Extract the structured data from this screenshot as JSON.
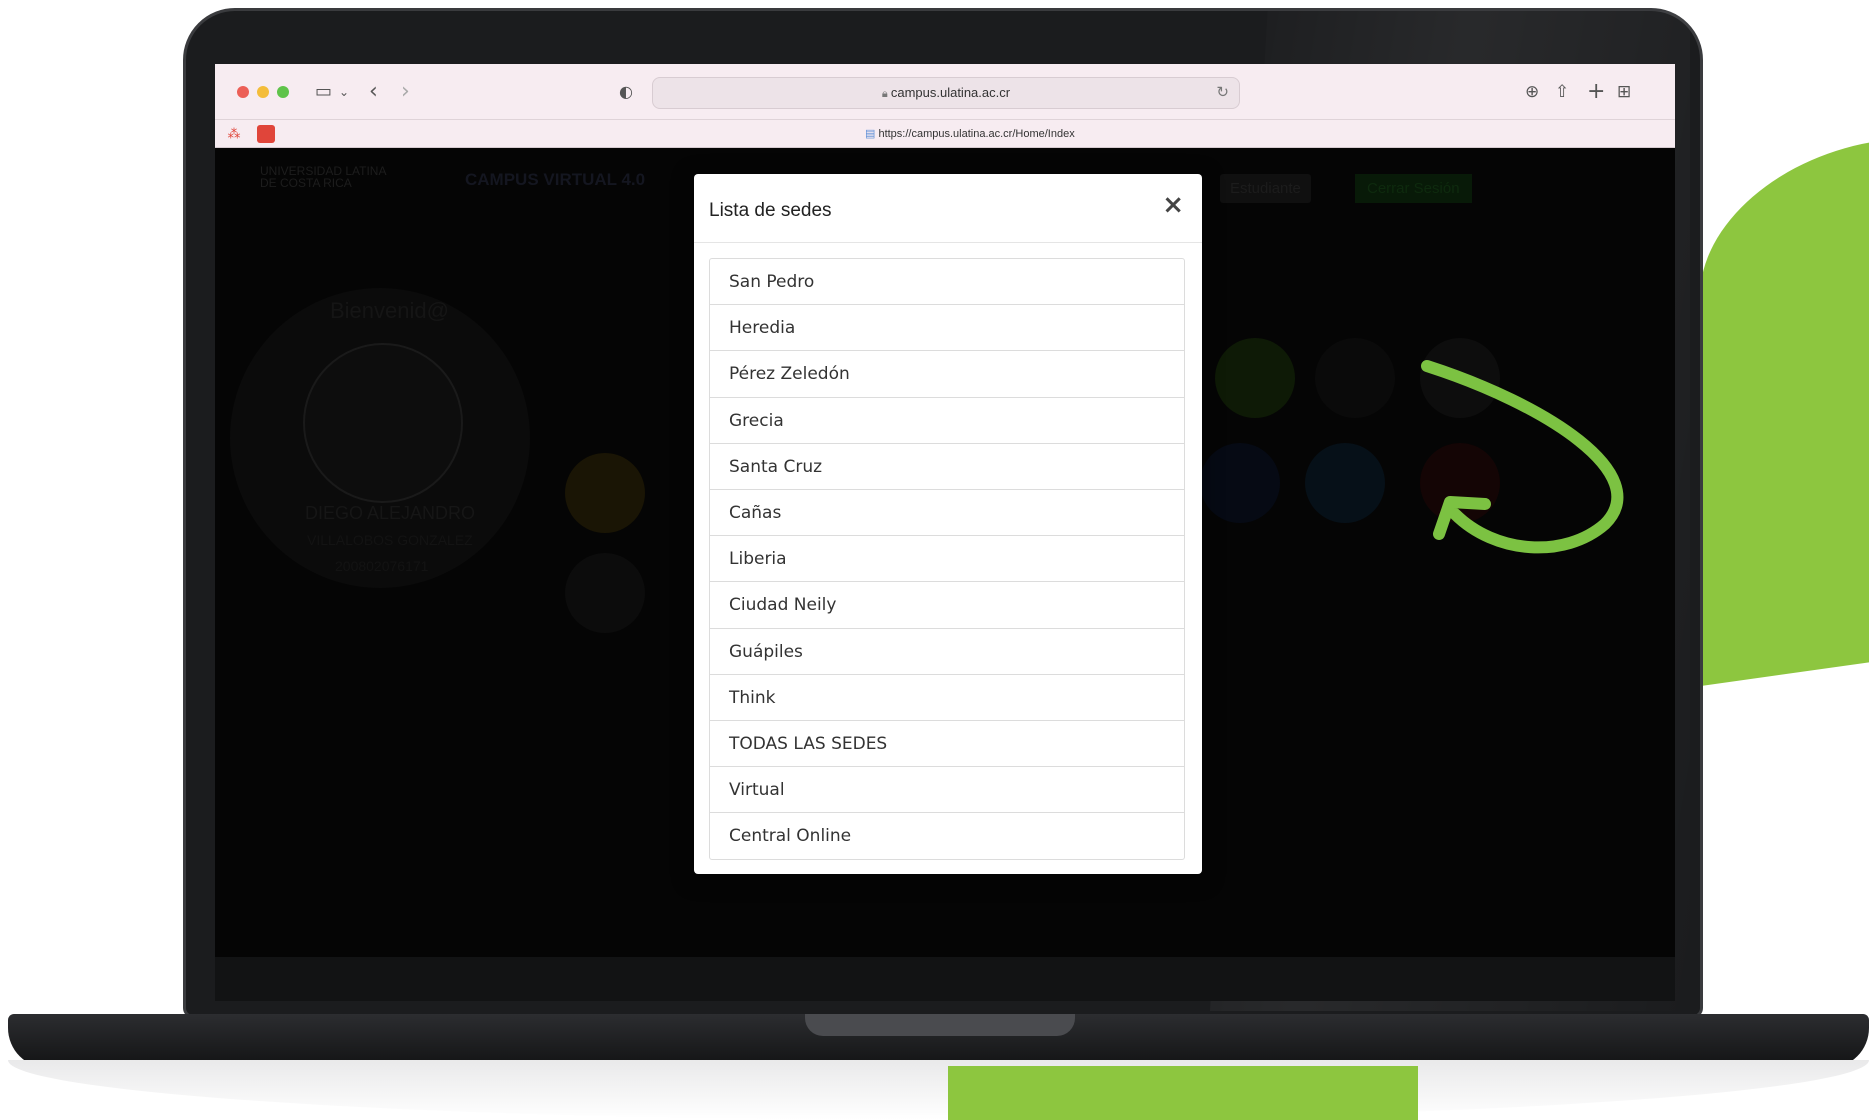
{
  "browser": {
    "url_display": "campus.ulatina.ac.cr",
    "full_url": "https://campus.ulatina.ac.cr/Home/Index"
  },
  "background_page": {
    "logo_line1": "UNIVERSIDAD LATINA",
    "logo_line2": "DE COSTA RICA",
    "app_title": "CAMPUS VIRTUAL 4.0",
    "role_select": "Estudiante",
    "logout_button": "Cerrar Sesión",
    "welcome": "Bienvenid@",
    "user_first_name": "DIEGO ALEJANDRO",
    "user_last_name": "VILLALOBOS GONZALEZ",
    "user_id": "200802076171"
  },
  "modal": {
    "title": "Lista de sedes",
    "close_label": "×",
    "items": [
      "San Pedro",
      "Heredia",
      "Pérez Zeledón",
      "Grecia",
      "Santa Cruz",
      "Cañas",
      "Liberia",
      "Ciudad Neily",
      "Guápiles",
      "Think",
      "TODAS LAS SEDES",
      "Virtual",
      "Central Online"
    ]
  },
  "colors": {
    "accent_green": "#8dc63f",
    "arrow_green": "#7cc242"
  }
}
